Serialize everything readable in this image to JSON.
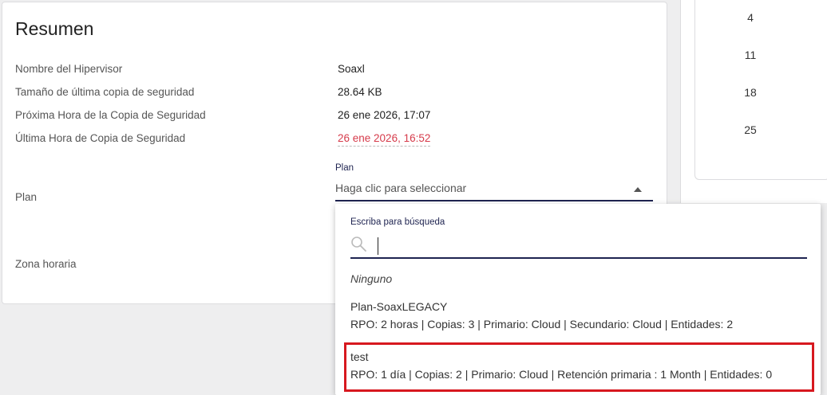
{
  "summary": {
    "title": "Resumen",
    "rows": [
      {
        "label": "Nombre del Hipervisor",
        "value": "Soaxl"
      },
      {
        "label": "Tamaño de última copia de seguridad",
        "value": "28.64 KB"
      },
      {
        "label": "Próxima Hora de la Copia de Seguridad",
        "value": "26 ene 2026, 17:07"
      },
      {
        "label": "Última Hora de Copia de Seguridad",
        "value": "26 ene 2026, 16:52"
      }
    ],
    "plan_label": "Plan",
    "timezone_label": "Zona horaria"
  },
  "plan_select": {
    "floating_label": "Plan",
    "placeholder": "Haga clic para seleccionar"
  },
  "calendar": {
    "days": [
      "4",
      "11",
      "18",
      "25"
    ]
  },
  "dropdown": {
    "search_label": "Escriba para búsqueda",
    "search_value": "",
    "none_option": "Ninguno",
    "options": [
      {
        "name": "Plan-SoaxLEGACY",
        "detail": "RPO: 2 horas | Copias: 3 | Primario: Cloud | Secundario: Cloud | Entidades: 2"
      },
      {
        "name": "test",
        "detail": "RPO: 1 día | Copias: 2 | Primario: Cloud | Retención primaria : 1 Month | Entidades: 0"
      }
    ]
  },
  "colors": {
    "accent": "#1e2350",
    "danger": "#d63b4b",
    "highlight": "#d7181f"
  },
  "icons": {
    "search": "search-icon",
    "caret": "caret-up-icon"
  }
}
